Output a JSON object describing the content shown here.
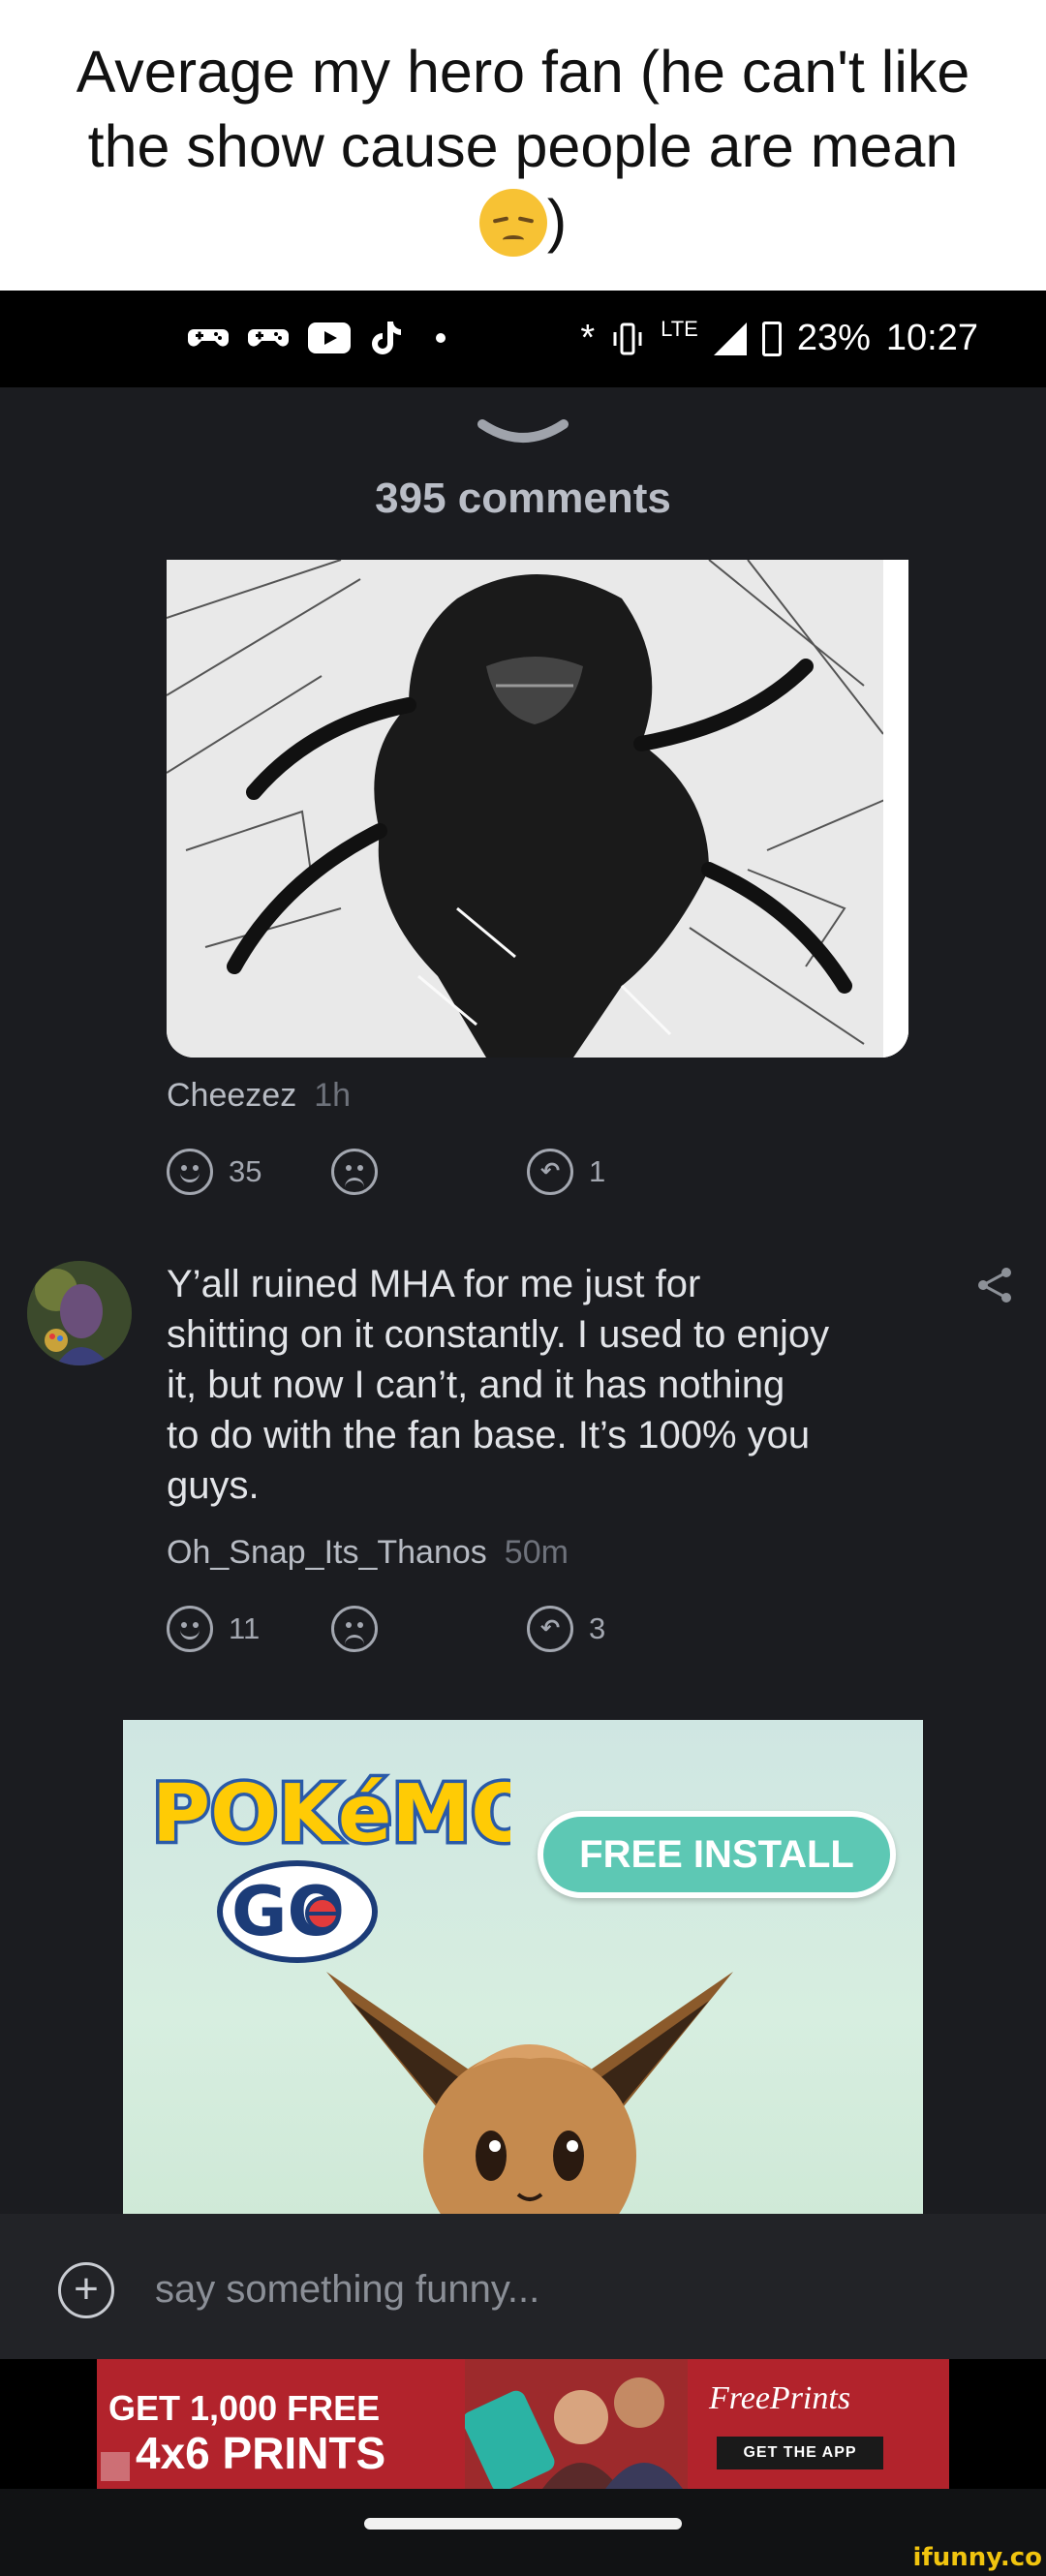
{
  "caption": {
    "line1": "Average my hero fan (he can't like",
    "line2": "the show cause people are mean",
    "close": ")",
    "emoji": "pensive-face-emoji"
  },
  "status_bar": {
    "bluetooth": "*",
    "network": "LTE",
    "battery": "23%",
    "time": "10:27"
  },
  "sheet": {
    "comments_count_label": "395 comments"
  },
  "comment1": {
    "user": "Cheezez",
    "time": "1h",
    "likes": "35",
    "replies": "1"
  },
  "comment2": {
    "lines": [
      "Y’all ruined MHA for me just for",
      "shitting on it constantly. I used to enjoy",
      "it, but now I can’t, and it has nothing",
      "to do with the fan base. It’s 100% you",
      "guys."
    ],
    "user": "Oh_Snap_Its_Thanos",
    "time": "50m",
    "likes": "11",
    "replies": "3"
  },
  "ad": {
    "logo_top": "POKéMON",
    "logo_bottom": "GO",
    "button": "FREE INSTALL"
  },
  "input": {
    "placeholder": "say something funny..."
  },
  "banner": {
    "headline1": "GET 1,000 FREE",
    "headline2": "4x6 PRINTS",
    "brand": "FreePrints",
    "cta": "GET THE APP"
  },
  "watermark": "ifunny.co",
  "colors": {
    "background": "#1b1c20",
    "text": "#e2e4e8",
    "muted": "#a3a7b0",
    "install_button": "#5dc8b4",
    "banner_red": "#b2232c"
  }
}
